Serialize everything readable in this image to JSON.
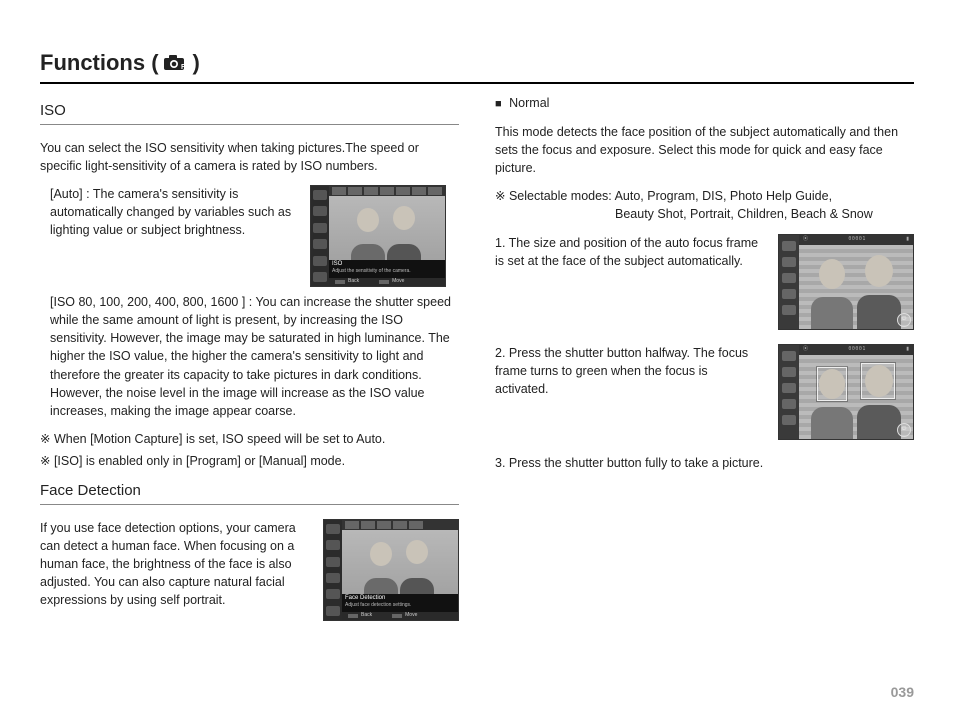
{
  "page": {
    "title_prefix": "Functions (",
    "title_suffix": ")",
    "page_number": "039"
  },
  "left": {
    "iso_heading": "ISO",
    "iso_intro": "You can select the ISO sensitivity when taking pictures.The speed or specific light-sensitivity of a camera is rated by ISO numbers.",
    "auto_label": "[Auto] : The camera's sensitivity is automatically changed by variables such as lighting value or subject brightness.",
    "iso_list": "[ISO 80, 100, 200, 400, 800, 1600 ] : You can increase the shutter speed while the same amount of light is present, by increasing the ISO sensitivity. However, the image may be saturated in high luminance. The higher the ISO value, the higher the camera's sensitivity to light and therefore the greater its capacity to take pictures in dark conditions. However, the noise level in the image will increase as the ISO value increases, making the image appear coarse.",
    "note1": "※ When [Motion Capture] is set, ISO speed will be set to Auto.",
    "note2": "※ [ISO] is enabled only in [Program] or [Manual] mode.",
    "fd_heading": "Face Detection",
    "fd_intro": "If you use face detection options, your camera can detect a human face. When focusing on a human face, the brightness of the face is also adjusted. You can also capture natural facial expressions by using self portrait.",
    "lcd_iso_title": "ISO",
    "lcd_iso_desc": "Adjust the sensitivity of the camera.",
    "lcd_fd_title": "Face Detection",
    "lcd_fd_desc": "Adjust face detection settings.",
    "lcd_back": "Back",
    "lcd_move": "Move"
  },
  "right": {
    "normal_bullet": "■",
    "normal_label": "Normal",
    "normal_desc": "This mode detects the face position of the subject automatically and then sets the focus and exposure. Select this mode for quick and easy face picture.",
    "selmodes_label": "※ Selectable modes: Auto, Program, DIS, Photo Help Guide,",
    "selmodes_line2": "Beauty Shot, Portrait, Children, Beach & Snow",
    "step1": "1. The size and position of the auto focus frame is set at the face of the subject automatically.",
    "step2": "2. Press the shutter button halfway. The focus frame turns to green when the focus is activated.",
    "step3": "3. Press the shutter button fully to take a picture.",
    "counter": "00001"
  }
}
